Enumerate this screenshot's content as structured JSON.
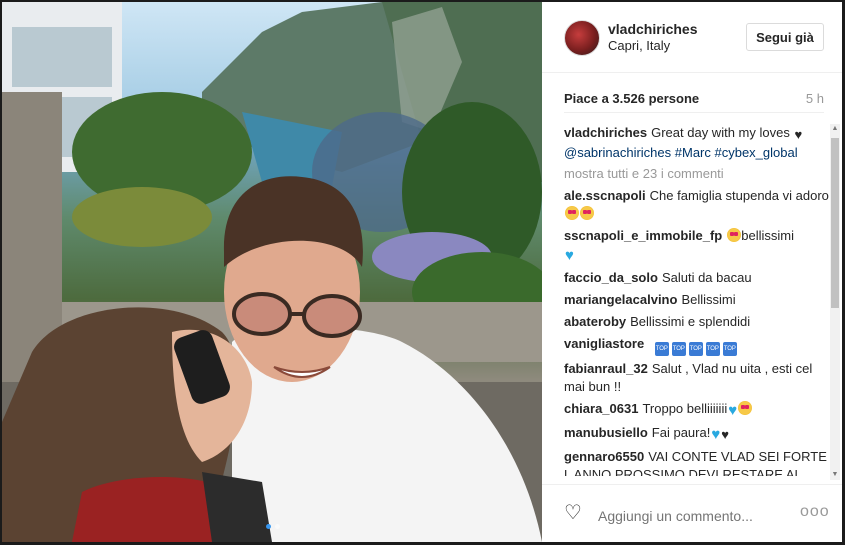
{
  "post": {
    "carousel": {
      "count": 2,
      "active": 0
    }
  },
  "header": {
    "username": "vladchiriches",
    "location": "Capri, Italy",
    "follow_label": "Segui già"
  },
  "stats": {
    "likes": "Piace a 3.526 persone",
    "time": "5 h"
  },
  "caption": {
    "user": "vladchiriches",
    "text": "Great day with my loves",
    "mention": "@sabrinachiriches",
    "tags": "#Marc #cybex_global"
  },
  "more_comments": "mostra tutti e 23 i commenti",
  "comments": [
    {
      "user": "ale.sscnapoli",
      "text": "Che famiglia stupenda vi adoro"
    },
    {
      "user": "sscnapoli_e_immobile_fp",
      "text": "bellissimi"
    },
    {
      "user": "faccio_da_solo",
      "text": "Saluti da bacau"
    },
    {
      "user": "mariangelacalvino",
      "text": "Bellissimi"
    },
    {
      "user": "abateroby",
      "text": "Bellissimi e splendidi"
    },
    {
      "user": "vanigliastore",
      "text": ""
    },
    {
      "user": "fabianraul_32",
      "text": "Salut , Vlad nu uita , esti cel mai bun !!"
    },
    {
      "user": "chiara_0631",
      "text": "Troppo belliiiiiii"
    },
    {
      "user": "manubusiello",
      "text": "Fai paura!"
    },
    {
      "user": "gennaro6550",
      "text": "VAI CONTE VLAD SEI FORTE L ANNO PROSSIMO DEVI RESTARE AL NAPOLI"
    }
  ],
  "top_badge": "TOP",
  "footer": {
    "comment_placeholder": "Aggiungi un commento...",
    "more_label": "ooo"
  }
}
